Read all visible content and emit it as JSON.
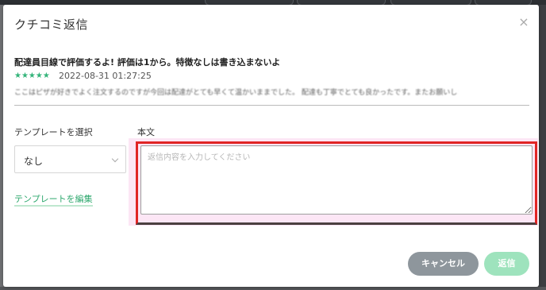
{
  "dialog": {
    "title": "クチコミ返信",
    "close_icon": "×"
  },
  "review": {
    "title": "配達員目線で評価するよ! 評価は1から。特徴なしは書き込まないよ",
    "rating": 5,
    "stars": "★★★★★",
    "date": "2022-08-31 01:27:25",
    "body": "ここはピザが好きでよく注文するのですが今回は配達がとても早くて温かいままでした。 配達も丁寧でとても良かったです。またお願いします。"
  },
  "form": {
    "template_label": "テンプレートを選択",
    "body_label": "本文",
    "template_select_value": "なし",
    "template_edit_link": "テンプレートを編集",
    "reply_placeholder": "返信内容を入力してください",
    "reply_value": ""
  },
  "actions": {
    "cancel_label": "キャンセル",
    "send_label": "返信"
  },
  "colors": {
    "accent_green": "#2fa86e",
    "star_green": "#34b47a",
    "highlight_red": "#e02525",
    "cancel_gray": "#8e969c",
    "send_green_disabled": "#9ee3bd"
  }
}
